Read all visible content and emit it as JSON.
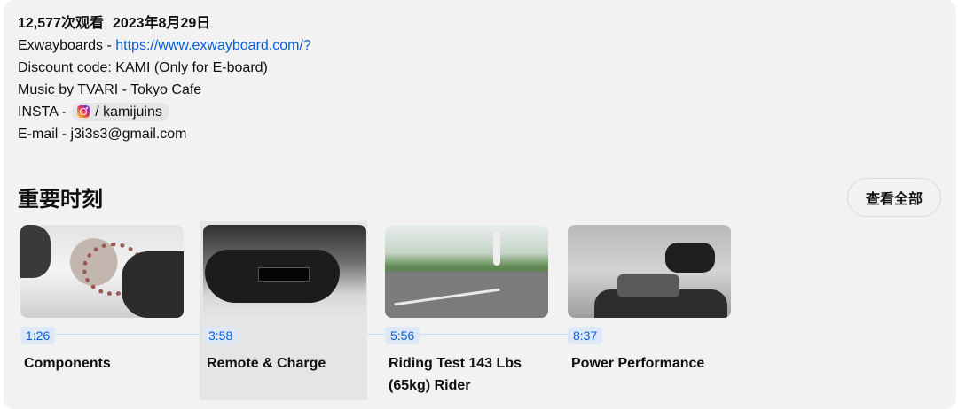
{
  "description": {
    "views": "12,577次观看",
    "date": "2023年8月29日",
    "line1_prefix": "Exwayboards - ",
    "line1_link": "https://www.exwayboard.com/?",
    "line2": "Discount code: KAMI (Only for E-board)",
    "line3": "Music by TVARI - Tokyo Cafe",
    "insta_prefix": "INSTA - ",
    "insta_handle": "/ kamijuins",
    "email": "E-mail - j3i3s3@gmail.com"
  },
  "key_moments": {
    "title": "重要时刻",
    "view_all": "查看全部",
    "chapters": [
      {
        "time": "1:26",
        "title": "Components"
      },
      {
        "time": "3:58",
        "title": "Remote & Charge"
      },
      {
        "time": "5:56",
        "title": "Riding Test 143 Lbs (65kg) Rider"
      },
      {
        "time": "8:37",
        "title": "Power Performance"
      }
    ]
  },
  "colors": {
    "link": "#065fd4",
    "panel_bg": "#f2f2f2",
    "active_chapter_bg": "#e5e5e5"
  }
}
